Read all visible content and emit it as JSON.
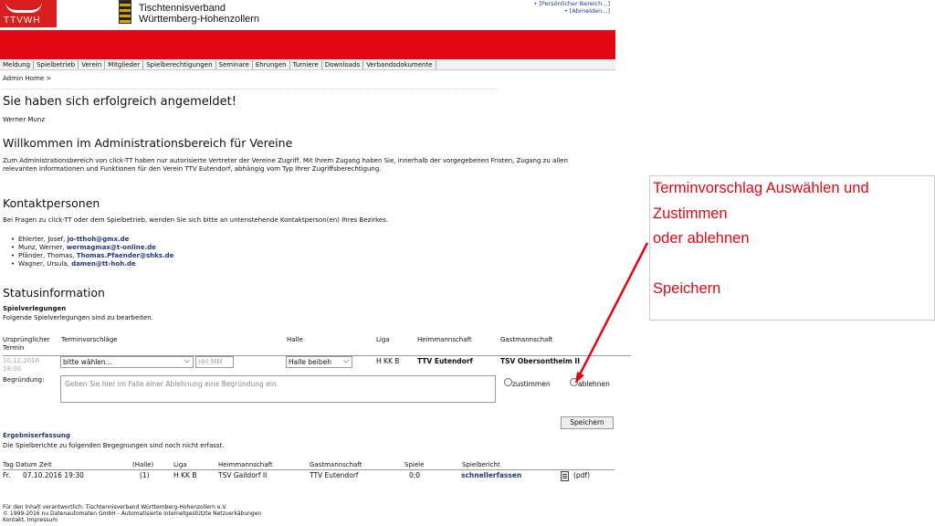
{
  "header": {
    "logo_text": "TTVWH",
    "org_line1": "Tischtennisverband",
    "org_line2": "Württemberg-Hohenzollern",
    "top_links": [
      "• [Persönlicher Bereich...]",
      "• [Abmelden...]"
    ],
    "brand_color": "#e30613"
  },
  "menu": [
    "Meldung",
    "Spielbetrieb",
    "Verein",
    "Mitglieder",
    "Spielberechtigungen",
    "Seminare",
    "Ehrungen",
    "Turniere",
    "Downloads",
    "Verbandsdokumente"
  ],
  "breadcrumb": "Admin Home >",
  "main": {
    "title": "Sie haben sich erfolgreich angemeldet!",
    "user_name": "Werner Munz",
    "welcome_heading": "Willkommen im Administrationsbereich für Vereine",
    "intro_text": "Zum Administrationsbereich von click-TT haben nur autorisierte Vertreter der Vereine Zugriff. Mit Ihrem Zugang haben Sie, innerhalb der vorgegebenen Fristen, Zugang zu allen relevanten Informationen und Funktionen für den Verein TTV Eutendorf, abhängig vom Typ Ihrer Zugriffsberechtigung.",
    "contact_heading": "Kontaktpersonen",
    "contact_intro": "Bei Fragen zu click-TT oder dem Spielbetrieb, wenden Sie sich bitte an untenstehende Kontaktperson(en) Ihres Bezirkes.",
    "contacts": [
      {
        "name": "Ehlerter, Josef,",
        "email": "jo-tthoh@gmx.de"
      },
      {
        "name": "Munz, Werner,",
        "email": "wermagmax@t-online.de"
      },
      {
        "name": "Pfänder, Thomas,",
        "email": "Thomas.Pfaender@shks.de"
      },
      {
        "name": "Wagner, Ursula,",
        "email": "damen@tt-hoh.de"
      }
    ],
    "status_heading": "Statusinformation"
  },
  "moves": {
    "heading": "Spielverlegungen",
    "intro": "Folgende Spielverlegungen sind zu bearbeiten.",
    "columns": [
      "Ursprünglicher Termin",
      "Terminvorschläge",
      "Halle",
      "Liga",
      "Heimmannschaft",
      "Gastmannschaft"
    ],
    "row": {
      "orig_date": "10.12.2016",
      "orig_time": "18:00",
      "proposal_select": "bitte wählen...",
      "time_placeholder": "HH:MM",
      "hall_select": "Halle beibeh",
      "league": "H KK B",
      "home": "TTV Eutendorf",
      "guest": "TSV Obersontheim II"
    },
    "reason_label": "Begründung:",
    "reason_placeholder": "Geben Sie hier im Falle einer Ablehnung eine Begründung ein.",
    "agree_label": "zustimmen",
    "reject_label": "ablehnen",
    "save_label": "Speichern"
  },
  "results": {
    "heading": "Ergebniserfassung",
    "intro": "Die Spielberichte zu folgenden Begegnungen sind noch nicht erfasst.",
    "columns": [
      "Tag Datum Zeit",
      "(Halle)",
      "Liga",
      "Heimmannschaft",
      "Gastmannschaft",
      "Spiele",
      "Spielbericht"
    ],
    "row": {
      "day": "Fr.",
      "datetime": "07.10.2016 19:30",
      "hall": "(1)",
      "league": "H KK B",
      "home": "TSV Gaildorf II",
      "guest": "TTV Eutendorf",
      "games": "0:0",
      "report_link": "schnellerfassen",
      "pdf_label": "(pdf)"
    }
  },
  "footer": [
    "Für den Inhalt verantwortlich: Tischtennisverband Württemberg-Hohenzollern e.V.",
    "© 1999-2016 nu Datenautomaten GmbH - Automatisierte internetgestützte Netzverkäbungen",
    "Kontakt, Impressum"
  ],
  "annotation": {
    "lines": [
      "Terminvorschlag Auswählen und",
      "Zustimmen",
      "oder ablehnen",
      "",
      "Speichern"
    ],
    "color": "#e30613"
  }
}
